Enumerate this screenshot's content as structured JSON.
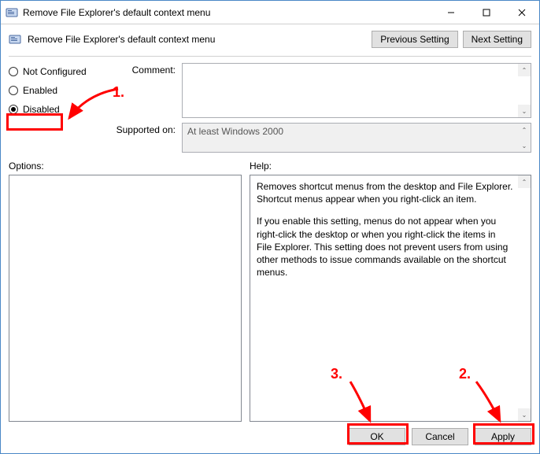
{
  "window": {
    "title": "Remove File Explorer's default context menu"
  },
  "header": {
    "title": "Remove File Explorer's default context menu",
    "previous_setting": "Previous Setting",
    "next_setting": "Next Setting"
  },
  "radios": {
    "not_configured": "Not Configured",
    "enabled": "Enabled",
    "disabled": "Disabled",
    "selected": "disabled"
  },
  "fields": {
    "comment_label": "Comment:",
    "comment_value": "",
    "supported_label": "Supported on:",
    "supported_value": "At least Windows 2000"
  },
  "panels": {
    "options_label": "Options:",
    "help_label": "Help:",
    "help_p1": "Removes shortcut menus from the desktop and File Explorer. Shortcut menus appear when you right-click an item.",
    "help_p2": "If you enable this setting, menus do not appear when you right-click the desktop or when you right-click the items in File Explorer. This setting does not prevent users from using other methods to issue commands available on the shortcut menus."
  },
  "footer": {
    "ok": "OK",
    "cancel": "Cancel",
    "apply": "Apply"
  },
  "annotations": {
    "n1": "1.",
    "n2": "2.",
    "n3": "3."
  }
}
